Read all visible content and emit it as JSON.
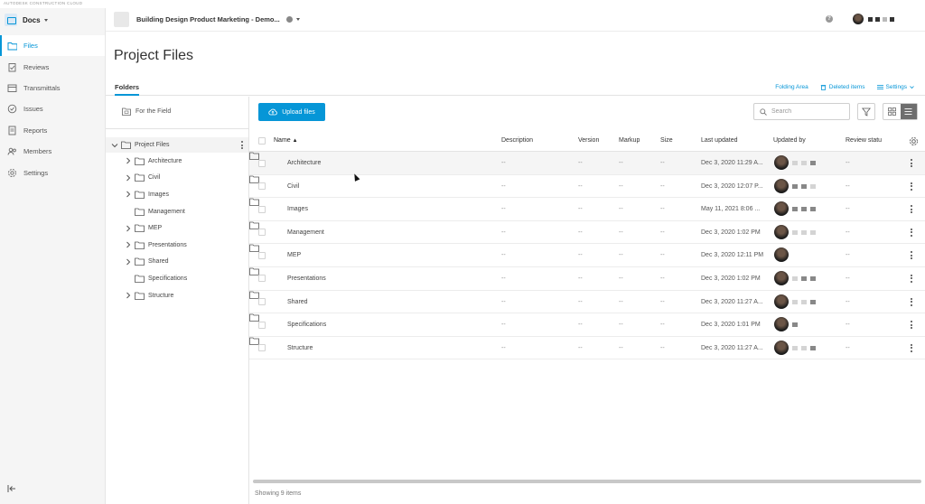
{
  "brand": {
    "label": "AUTODESK CONSTRUCTION CLOUD"
  },
  "app": {
    "name": "Docs"
  },
  "nav": {
    "items": [
      {
        "label": "Files",
        "icon": "folder-icon",
        "active": true
      },
      {
        "label": "Reviews",
        "icon": "reviews-icon",
        "active": false
      },
      {
        "label": "Transmittals",
        "icon": "transmittals-icon",
        "active": false
      },
      {
        "label": "Issues",
        "icon": "issues-icon",
        "active": false
      },
      {
        "label": "Reports",
        "icon": "reports-icon",
        "active": false
      },
      {
        "label": "Members",
        "icon": "members-icon",
        "active": false
      },
      {
        "label": "Settings",
        "icon": "gear-icon",
        "active": false
      }
    ]
  },
  "header": {
    "project_name": "Building Design Product Marketing - Demo..."
  },
  "page": {
    "title": "Project Files"
  },
  "tabs": {
    "folders": "Folders",
    "folding_area": "Folding Area",
    "deleted_items": "Deleted items",
    "settings": "Settings"
  },
  "sidebar": {
    "field_label": "For the Field",
    "root_label": "Project Files",
    "tree": [
      {
        "label": "Architecture",
        "expandable": true
      },
      {
        "label": "Civil",
        "expandable": true
      },
      {
        "label": "Images",
        "expandable": true
      },
      {
        "label": "Management",
        "expandable": false
      },
      {
        "label": "MEP",
        "expandable": true
      },
      {
        "label": "Presentations",
        "expandable": true
      },
      {
        "label": "Shared",
        "expandable": true
      },
      {
        "label": "Specifications",
        "expandable": false
      },
      {
        "label": "Structure",
        "expandable": true
      }
    ]
  },
  "toolbar": {
    "upload_label": "Upload files",
    "search_placeholder": "Search"
  },
  "grid": {
    "columns": {
      "name": "Name",
      "description": "Description",
      "version": "Version",
      "markup": "Markup",
      "size": "Size",
      "last_updated": "Last updated",
      "updated_by": "Updated by",
      "review_status": "Review statu"
    },
    "rows": [
      {
        "name": "Architecture",
        "description": "--",
        "version": "--",
        "markup": "--",
        "size": "--",
        "last_updated": "Dec 3, 2020 11:29 A...",
        "review": "--"
      },
      {
        "name": "Civil",
        "description": "--",
        "version": "--",
        "markup": "--",
        "size": "--",
        "last_updated": "Dec 3, 2020 12:07 P...",
        "review": "--"
      },
      {
        "name": "Images",
        "description": "--",
        "version": "--",
        "markup": "--",
        "size": "--",
        "last_updated": "May 11, 2021 8:06 ...",
        "review": "--"
      },
      {
        "name": "Management",
        "description": "--",
        "version": "--",
        "markup": "--",
        "size": "--",
        "last_updated": "Dec 3, 2020 1:02 PM",
        "review": "--"
      },
      {
        "name": "MEP",
        "description": "--",
        "version": "--",
        "markup": "--",
        "size": "--",
        "last_updated": "Dec 3, 2020 12:11 PM",
        "review": "--"
      },
      {
        "name": "Presentations",
        "description": "--",
        "version": "--",
        "markup": "--",
        "size": "--",
        "last_updated": "Dec 3, 2020 1:02 PM",
        "review": "--"
      },
      {
        "name": "Shared",
        "description": "--",
        "version": "--",
        "markup": "--",
        "size": "--",
        "last_updated": "Dec 3, 2020 11:27 A...",
        "review": "--"
      },
      {
        "name": "Specifications",
        "description": "--",
        "version": "--",
        "markup": "--",
        "size": "--",
        "last_updated": "Dec 3, 2020 1:01 PM",
        "review": "--"
      },
      {
        "name": "Structure",
        "description": "--",
        "version": "--",
        "markup": "--",
        "size": "--",
        "last_updated": "Dec 3, 2020 11:27 A...",
        "review": "--"
      }
    ]
  },
  "footer": {
    "count_text": "Showing 9 items"
  },
  "colors": {
    "accent": "#0696d7",
    "nav_bg": "#f5f5f5",
    "border": "#e3e3e3"
  }
}
